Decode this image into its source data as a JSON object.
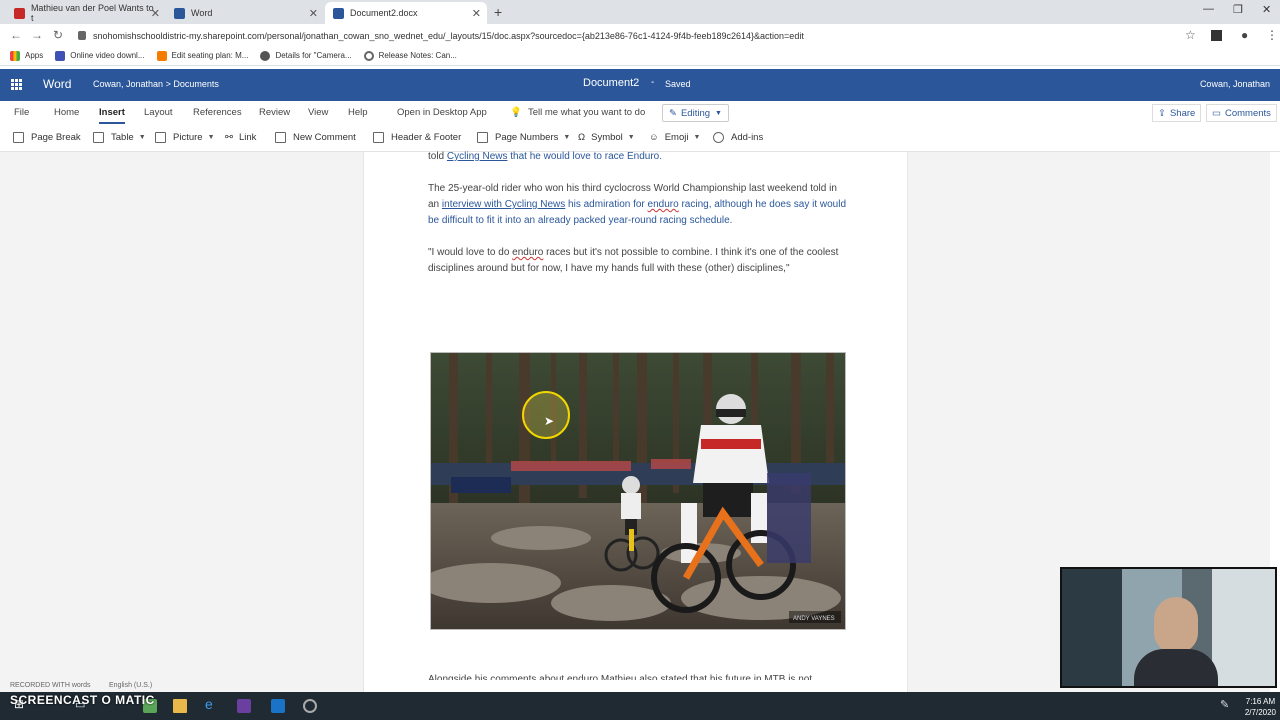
{
  "browser": {
    "tabs": [
      {
        "label": "Mathieu van der Poel Wants to t",
        "icon_color": "#c62828"
      },
      {
        "label": "Word",
        "icon_color": "#2b579a"
      },
      {
        "label": "Document2.docx",
        "icon_color": "#2b579a"
      }
    ],
    "url": "snohomishschooldistric-my.sharepoint.com/personal/jonathan_cowan_sno_wednet_edu/_layouts/15/doc.aspx?sourcedoc={ab213e86-76c1-4124-9f4b-feeb189c2614}&action=edit",
    "bookmarks": [
      "Apps",
      "Online video downl...",
      "Edit seating plan: M...",
      "Details for \"Camera...",
      "Release Notes: Can..."
    ]
  },
  "word": {
    "app_name": "Word",
    "breadcrumb_user": "Cowan, Jonathan",
    "breadcrumb_sep": ">",
    "breadcrumb_folder": "Documents",
    "doc_title": "Document2",
    "doc_sep": "-",
    "doc_status": "Saved",
    "user_name": "Cowan, Jonathan",
    "menus": [
      "File",
      "Home",
      "Insert",
      "Layout",
      "References",
      "Review",
      "View",
      "Help",
      "Open in Desktop App"
    ],
    "tell_me": "Tell me what you want to do",
    "editing": "Editing",
    "share": "Share",
    "comments": "Comments",
    "ribbon": [
      "Page Break",
      "Table",
      "Picture",
      "Link",
      "New Comment",
      "Header & Footer",
      "Page Numbers",
      "Symbol",
      "Emoji",
      "Add-ins"
    ]
  },
  "document": {
    "line0_pre": "told ",
    "line0_link": "Cycling News",
    "line0_post": " that he would love to race Enduro.",
    "para1_a": "The 25-year-old rider who won his third cyclocross World Championship last weekend told in an ",
    "para1_link": "interview with Cycling News",
    "para1_b": " his admiration for ",
    "para1_c": "enduro",
    "para1_d": " racing, although he does say it would be difficult to fit it into an already packed year-round racing schedule.",
    "para2_a": "\"I would love to do ",
    "para2_b": "enduro",
    "para2_c": " races but it's not possible to combine. I think it's one of the coolest disciplines around but for now, I have my hands full with these (other) disciplines,\"",
    "para3": "Alongside his comments about enduro Mathieu also stated that his future in MTB is not",
    "photo_credit": "ANDY VAYNES"
  },
  "status": {
    "words": "RECORDED WITH   words",
    "language": "English (U.S.)"
  },
  "watermark": "SCREENCAST O MATIC",
  "clock": {
    "time": "7:16 AM",
    "date": "2/7/2020"
  }
}
